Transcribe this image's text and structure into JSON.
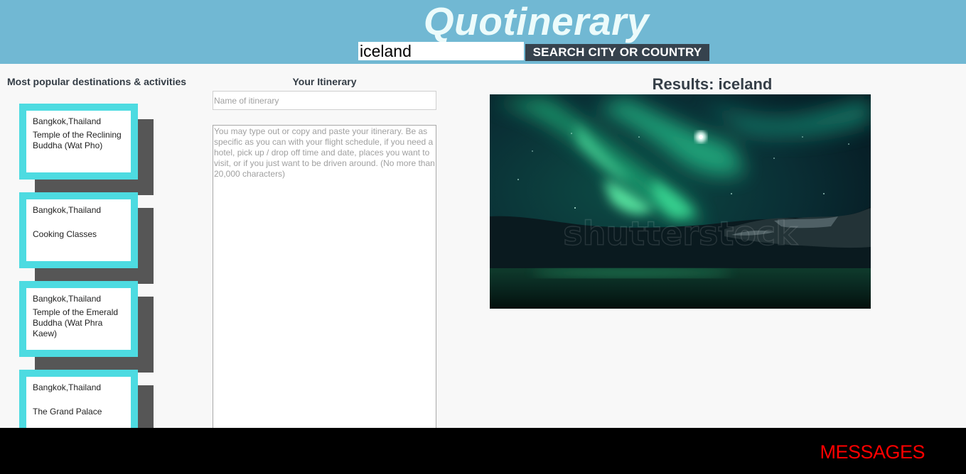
{
  "header": {
    "title": "Quotinerary",
    "search_value": "iceland",
    "search_button_label": "SEARCH CITY OR COUNTRY"
  },
  "sidebar": {
    "heading": "Most popular destinations & activities",
    "cards": [
      {
        "location": "Bangkok,Thailand",
        "activity": "Temple of the Reclining Buddha (Wat Pho)"
      },
      {
        "location": "Bangkok,Thailand",
        "activity": "Cooking Classes"
      },
      {
        "location": "Bangkok,Thailand",
        "activity": "Temple of the Emerald Buddha (Wat Phra Kaew)"
      },
      {
        "location": "Bangkok,Thailand",
        "activity": "The Grand Palace"
      }
    ]
  },
  "itinerary": {
    "heading": "Your Itinerary",
    "name_placeholder": "Name of itinerary",
    "text_placeholder": "You may type out or copy and paste your itinerary. Be as specific as you can with your flight schedule, if you need a hotel, pick up / drop off time and date, places you want to visit, or if you just want to be driven around. (No more than 20,000 characters)"
  },
  "results": {
    "title": "Results: iceland",
    "image_watermark": "shutterstock"
  },
  "footer": {
    "messages_label": "MESSAGES"
  },
  "colors": {
    "header_bg": "#71b8d3",
    "title_color": "#ecfbfb",
    "card_border": "#4ddbe1",
    "card_shadow": "#565656",
    "search_button_bg": "#36424d",
    "footer_bg": "#000000",
    "messages_color": "#ff0000"
  }
}
